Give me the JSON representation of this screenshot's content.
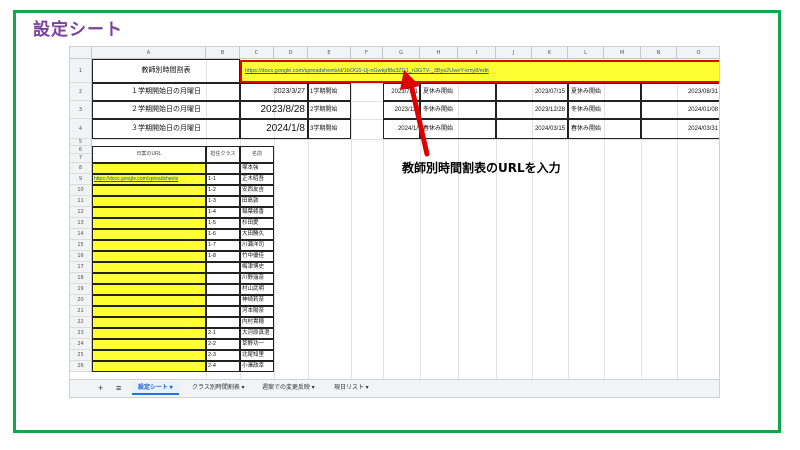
{
  "slide_title": "設定シート",
  "callout": "教師別時間割表のURLを入力",
  "columns": [
    "A",
    "B",
    "C",
    "D",
    "E",
    "F",
    "G",
    "H",
    "I",
    "J",
    "K",
    "L",
    "M",
    "N",
    "O"
  ],
  "row_numbers": [
    "1",
    "2",
    "3",
    "4",
    "5",
    "6",
    "7",
    "8",
    "9",
    "10",
    "11",
    "12",
    "13",
    "14",
    "15",
    "16",
    "17",
    "18",
    "19",
    "20",
    "21",
    "22",
    "23",
    "24",
    "25",
    "26"
  ],
  "row1": {
    "label": "教師別時間割表",
    "url": "https://docs.google.com/spreadsheets/d/1bOG5-Uj-nGwkpf8a3ZG1_n3GTV-_3Bys2UweY-kmy8/edit"
  },
  "terms": [
    {
      "label": "１学期開始日の月曜日",
      "start": "2023/3/27",
      "start_label": "1学期開始",
      "vac_start": "2023/7/31",
      "vac_start_label": "夏休み開始",
      "vac_end": "2023/07/15",
      "vac_end_label": "夏休み開始",
      "last": "2023/08/31"
    },
    {
      "label": "２学期開始日の月曜日",
      "start": "2023/8/28",
      "start_label": "2学期開始",
      "vac_start": "2023/12/",
      "vac_start_label": "冬休み開始",
      "vac_end": "2023/12/28",
      "vac_end_label": "冬休み開始",
      "last": "2024/01/08"
    },
    {
      "label": "３学期開始日の月曜日",
      "start": "2024/1/8",
      "start_label": "3学期開始",
      "vac_start": "2024/1/",
      "vac_start_label": "春休み開始",
      "vac_end": "2024/03/15",
      "vac_end_label": "春休み開始",
      "last": "2024/03/31"
    }
  ],
  "list_headers": {
    "url": "日案のURL",
    "class": "担任クラス",
    "name": "名前"
  },
  "list_rows": [
    {
      "url": "",
      "class": "",
      "name": "塚本強"
    },
    {
      "url": "https://docs.google.com/spreadsheets",
      "class": "1-1",
      "name": "正木昭吾"
    },
    {
      "url": "",
      "class": "1-2",
      "name": "安西友吉"
    },
    {
      "url": "",
      "class": "1-3",
      "name": "田島敦"
    },
    {
      "url": "",
      "class": "1-4",
      "name": "稲葉綾香"
    },
    {
      "url": "",
      "class": "1-5",
      "name": "杉田愛"
    },
    {
      "url": "",
      "class": "1-6",
      "name": "大田勝久"
    },
    {
      "url": "",
      "class": "1-7",
      "name": "川瀬洋司"
    },
    {
      "url": "",
      "class": "1-8",
      "name": "竹中優佳"
    },
    {
      "url": "",
      "class": "",
      "name": "梅津博史"
    },
    {
      "url": "",
      "class": "",
      "name": "川野瑞奈"
    },
    {
      "url": "",
      "class": "",
      "name": "村山武明"
    },
    {
      "url": "",
      "class": "",
      "name": "神崎莉奈"
    },
    {
      "url": "",
      "class": "",
      "name": "河本陽奈"
    },
    {
      "url": "",
      "class": "",
      "name": "内村貴穂"
    },
    {
      "url": "",
      "class": "2-1",
      "name": "大河原真澄"
    },
    {
      "url": "",
      "class": "2-2",
      "name": "草野功一"
    },
    {
      "url": "",
      "class": "2-3",
      "name": "北尾知里"
    },
    {
      "url": "",
      "class": "2-4",
      "name": "小澤政幸"
    }
  ],
  "tabs": [
    {
      "label": "+"
    },
    {
      "label": "≡"
    },
    {
      "label": "設定シート ▾"
    },
    {
      "label": "クラス別時間割表 ▾"
    },
    {
      "label": "週案での変更反映 ▾"
    },
    {
      "label": "現日リスト ▾"
    }
  ],
  "colors": {
    "frame": "#12a84a",
    "title": "#7b3fa0",
    "highlight": "#ffff33",
    "arrow": "#e00000",
    "link": "#1155cc"
  }
}
